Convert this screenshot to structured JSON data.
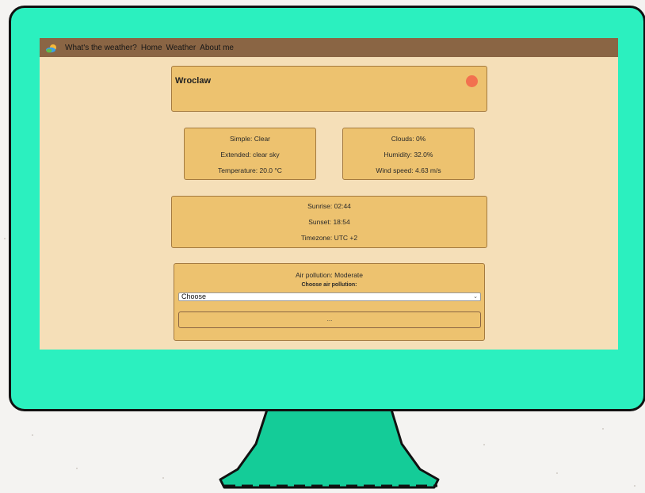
{
  "navbar": {
    "logo_icon": "weather-logo-icon",
    "brand": "What's the weather?",
    "links": [
      "Home",
      "Weather",
      "About me"
    ]
  },
  "city": {
    "name": "Wroclaw",
    "status_color": "#f2714f"
  },
  "weather": {
    "simple": "Simple: Clear",
    "extended": "Extended: clear sky",
    "temperature": "Temperature: 20.0 °C",
    "clouds": "Clouds: 0%",
    "humidity": "Humidity: 32.0%",
    "wind": "Wind speed: 4.63 m/s"
  },
  "sun": {
    "sunrise": "Sunrise: 02:44",
    "sunset": "Sunset: 18:54",
    "timezone": "Timezone: UTC +2"
  },
  "air": {
    "status": "Air pollution: Moderate",
    "choose_label": "Choose air pollution:",
    "select_value": "Choose",
    "button_label": "..."
  },
  "colors": {
    "monitor": "#2bf0bf",
    "stand": "#14cc98",
    "screen_bg": "#f5dfb8",
    "navbar": "#8a6544",
    "card": "#edc26f"
  }
}
